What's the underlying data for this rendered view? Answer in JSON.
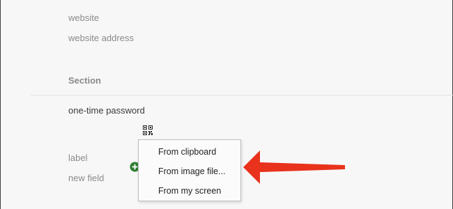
{
  "fields": {
    "website_label": "website",
    "website_value": "website address",
    "section_title": "Section",
    "otp_label": "one-time password",
    "label_placeholder": "label",
    "new_field_placeholder": "new field"
  },
  "context_menu": {
    "items": [
      "From clipboard",
      "From image file...",
      "From my screen"
    ]
  },
  "icons": {
    "qr": "qr-code-icon",
    "add": "plus-circle-icon",
    "annotation": "red-arrow"
  },
  "colors": {
    "add_icon": "#2e7d32",
    "arrow": "#e8321c",
    "muted_text": "#8a8a8a"
  }
}
